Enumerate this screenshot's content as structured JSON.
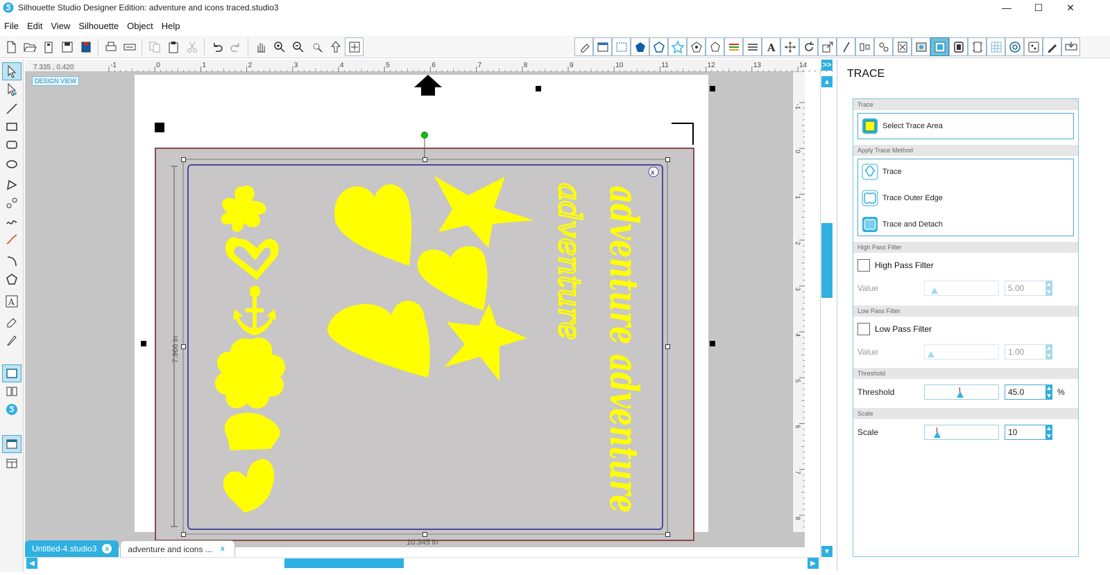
{
  "window": {
    "title": "Silhouette Studio Designer Edition: adventure and icons traced.studio3",
    "minimize": "—",
    "maximize": "☐",
    "close": "✕"
  },
  "menu": [
    "File",
    "Edit",
    "View",
    "Silhouette",
    "Object",
    "Help"
  ],
  "canvas": {
    "coords": "7.335 , 0.420",
    "design_view": "DESIGN VIEW",
    "ruler_top_labels": [
      "-1",
      "0",
      "1",
      "2",
      "3",
      "4",
      "5",
      "6",
      "7",
      "8",
      "9",
      "10",
      "11",
      "12",
      "13",
      "14"
    ],
    "ruler_left_labels": [
      "-1",
      "0",
      "1",
      "2",
      "3",
      "4",
      "5",
      "6",
      "7",
      "8"
    ],
    "height_dim": "7.966 in",
    "width_dim": "10.345 in",
    "text_bold": "adventure adventure",
    "text_script": "adventure",
    "shape_color": "#ffff00"
  },
  "tabs": [
    {
      "label": "Untitled-4.studio3",
      "close": "x"
    },
    {
      "label": "adventure and icons ...",
      "close": "x"
    }
  ],
  "panel": {
    "collapse": ">>",
    "title": "TRACE",
    "section_trace": "Trace",
    "select_trace_area": "Select Trace Area",
    "section_apply": "Apply Trace Method",
    "methods": [
      "Trace",
      "Trace Outer Edge",
      "Trace and Detach"
    ],
    "section_high": "High Pass Filter",
    "high_pass_label": "High Pass Filter",
    "high_value_label": "Value",
    "high_value": "5.00",
    "high_level": 0.05,
    "section_low": "Low Pass Filter",
    "low_pass_label": "Low Pass Filter",
    "low_value_label": "Value",
    "low_value": "1.00",
    "low_level": 0.0,
    "section_threshold": "Threshold",
    "threshold_label": "Threshold",
    "threshold_value": "45.0",
    "threshold_unit": "%",
    "threshold_level": 0.45,
    "section_scale": "Scale",
    "scale_label": "Scale",
    "scale_value": "10",
    "scale_level": 0.1
  },
  "colors": {
    "accent": "#2eb0e0",
    "trace_yellow": "#ffff00",
    "frame": "#4a4aa0"
  }
}
